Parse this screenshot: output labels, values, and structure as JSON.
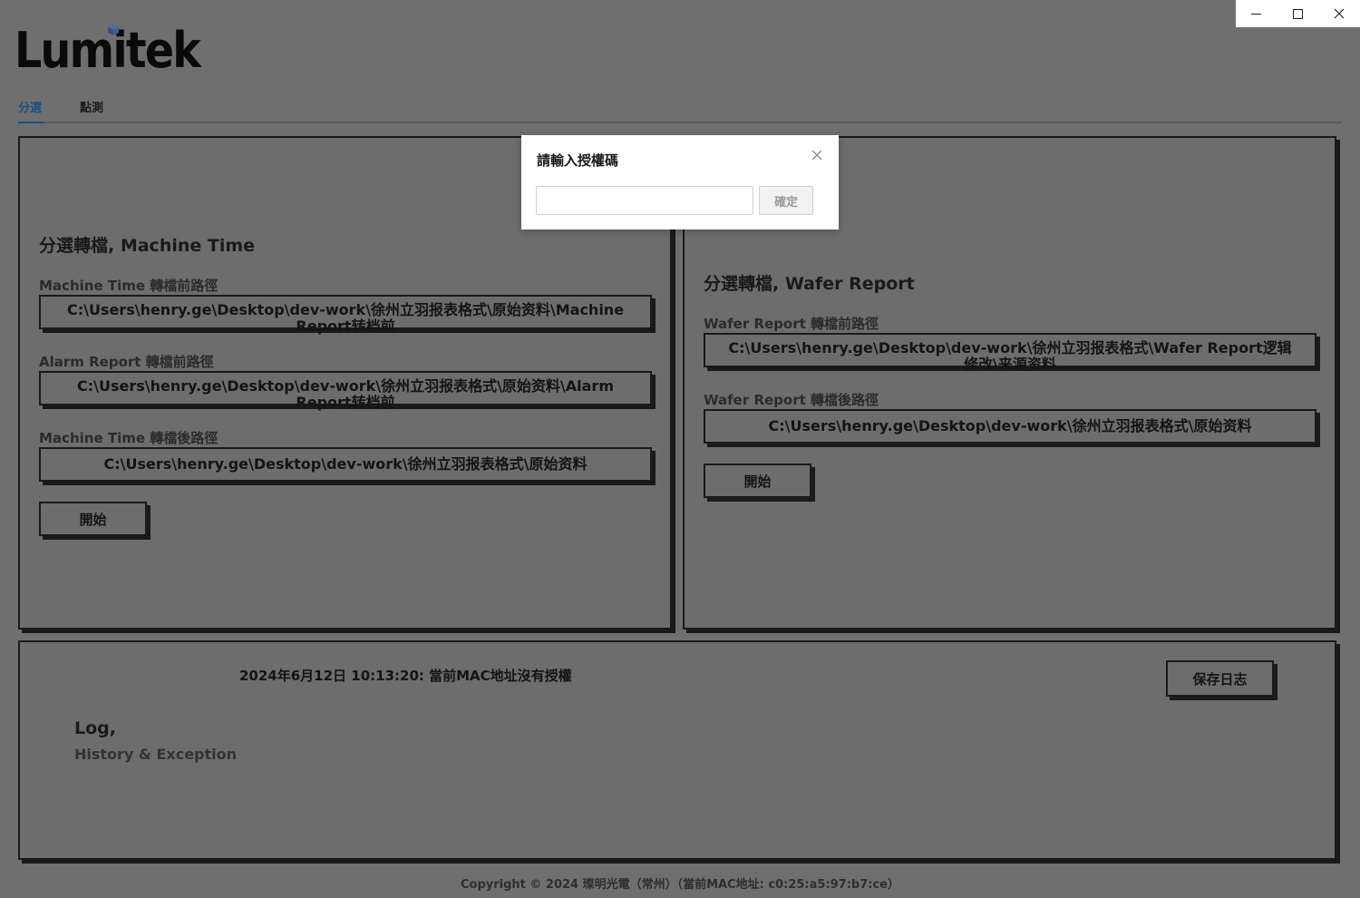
{
  "window": {
    "controls": [
      "minimize-icon",
      "maximize-icon",
      "close-icon"
    ]
  },
  "brand": {
    "logo_text": "Lumitek"
  },
  "tabs": [
    {
      "label": "分選",
      "active": true
    },
    {
      "label": "點測",
      "active": false
    }
  ],
  "machine_panel": {
    "title": "分選轉檔, Machine Time",
    "fields": [
      {
        "label": "Machine Time 轉檔前路徑",
        "value": "C:\\Users\\henry.ge\\Desktop\\dev-work\\徐州立羽报表格式\\原始资料\\Machine Report转档前"
      },
      {
        "label": "Alarm Report 轉檔前路徑",
        "value": "C:\\Users\\henry.ge\\Desktop\\dev-work\\徐州立羽报表格式\\原始资料\\Alarm Report转档前"
      },
      {
        "label": "Machine Time 轉檔後路徑",
        "value": "C:\\Users\\henry.ge\\Desktop\\dev-work\\徐州立羽报表格式\\原始资料"
      }
    ],
    "start_label": "開始"
  },
  "wafer_panel": {
    "title": "分選轉檔, Wafer Report",
    "fields": [
      {
        "label": "Wafer Report 轉檔前路徑",
        "value": "C:\\Users\\henry.ge\\Desktop\\dev-work\\徐州立羽报表格式\\Wafer Report逻辑修改\\来源资料"
      },
      {
        "label": "Wafer Report 轉檔後路徑",
        "value": "C:\\Users\\henry.ge\\Desktop\\dev-work\\徐州立羽报表格式\\原始资料"
      }
    ],
    "start_label": "開始"
  },
  "log_panel": {
    "message": "2024年6月12日 10:13:20: 當前MAC地址沒有授權",
    "title": "Log,",
    "subtitle": "History & Exception",
    "save_label": "保存日志"
  },
  "footer": {
    "text": "Copyright © 2024 璨明光電（常州）（當前MAC地址: c0:25:a5:97:b7:ce）"
  },
  "modal": {
    "title": "請輸入授權碼",
    "input_value": "",
    "confirm_label": "確定"
  },
  "colors": {
    "background": "#6f6f6f",
    "border": "#1a1a1a",
    "active_tab": "#1c4f86",
    "modal_bg": "#ffffff"
  }
}
